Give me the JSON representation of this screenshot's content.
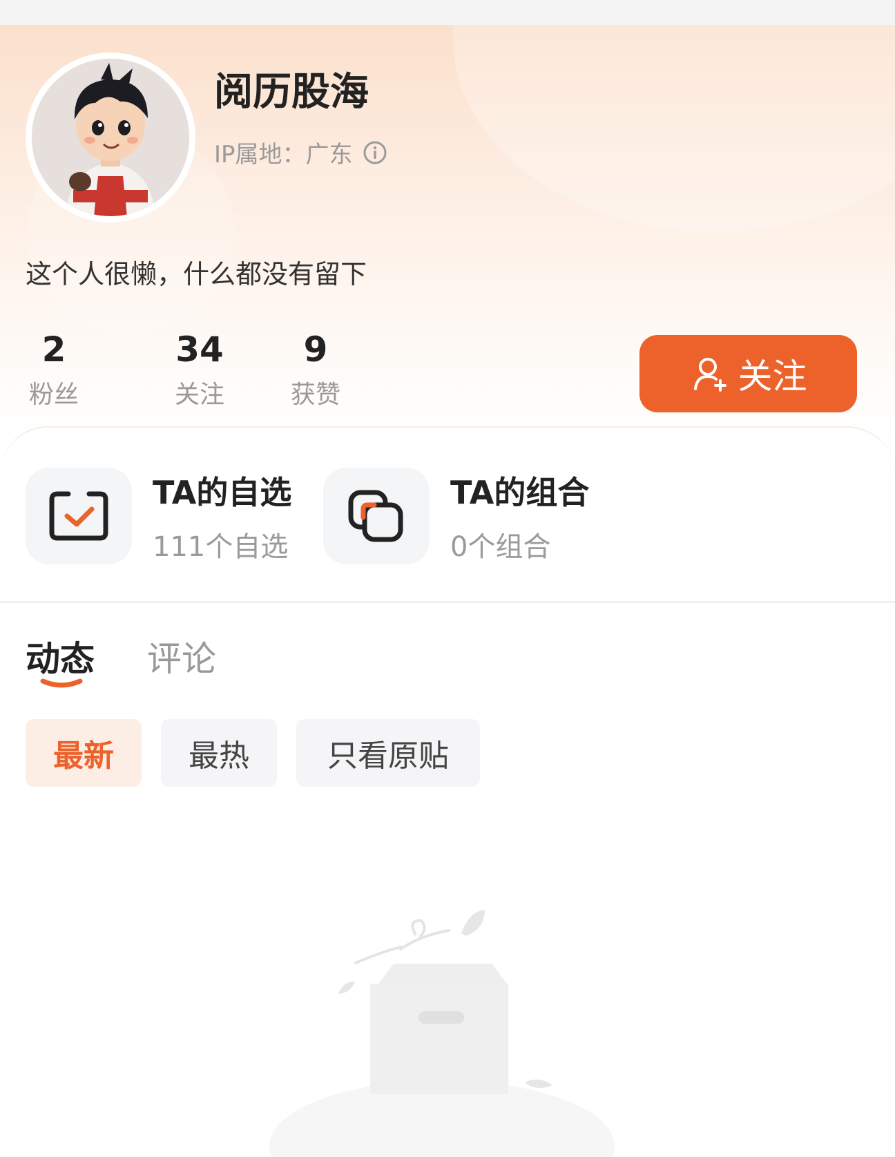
{
  "profile": {
    "username": "阅历股海",
    "ip_location": "IP属地：广东",
    "bio": "这个人很懒，什么都没有留下",
    "stats": [
      {
        "value": "2",
        "label": "粉丝"
      },
      {
        "value": "34",
        "label": "关注"
      },
      {
        "value": "9",
        "label": "获赞"
      }
    ],
    "follow_label": "关注"
  },
  "tiles": {
    "watchlist": {
      "title": "TA的自选",
      "subtitle": "111个自选"
    },
    "portfolio": {
      "title": "TA的组合",
      "subtitle": "0个组合"
    }
  },
  "tabs": [
    {
      "label": "动态",
      "active": true
    },
    {
      "label": "评论",
      "active": false
    }
  ],
  "filters": [
    {
      "label": "最新",
      "active": true
    },
    {
      "label": "最热",
      "active": false
    },
    {
      "label": "只看原贴",
      "active": false
    }
  ],
  "icons": {
    "info": "info-circle-icon",
    "follow": "add-user-icon",
    "watchlist": "checkbox-icon",
    "portfolio": "stacked-squares-icon",
    "empty": "empty-box-illustration"
  },
  "colors": {
    "accent": "#ec622a",
    "accent_light": "#fdeee5"
  }
}
